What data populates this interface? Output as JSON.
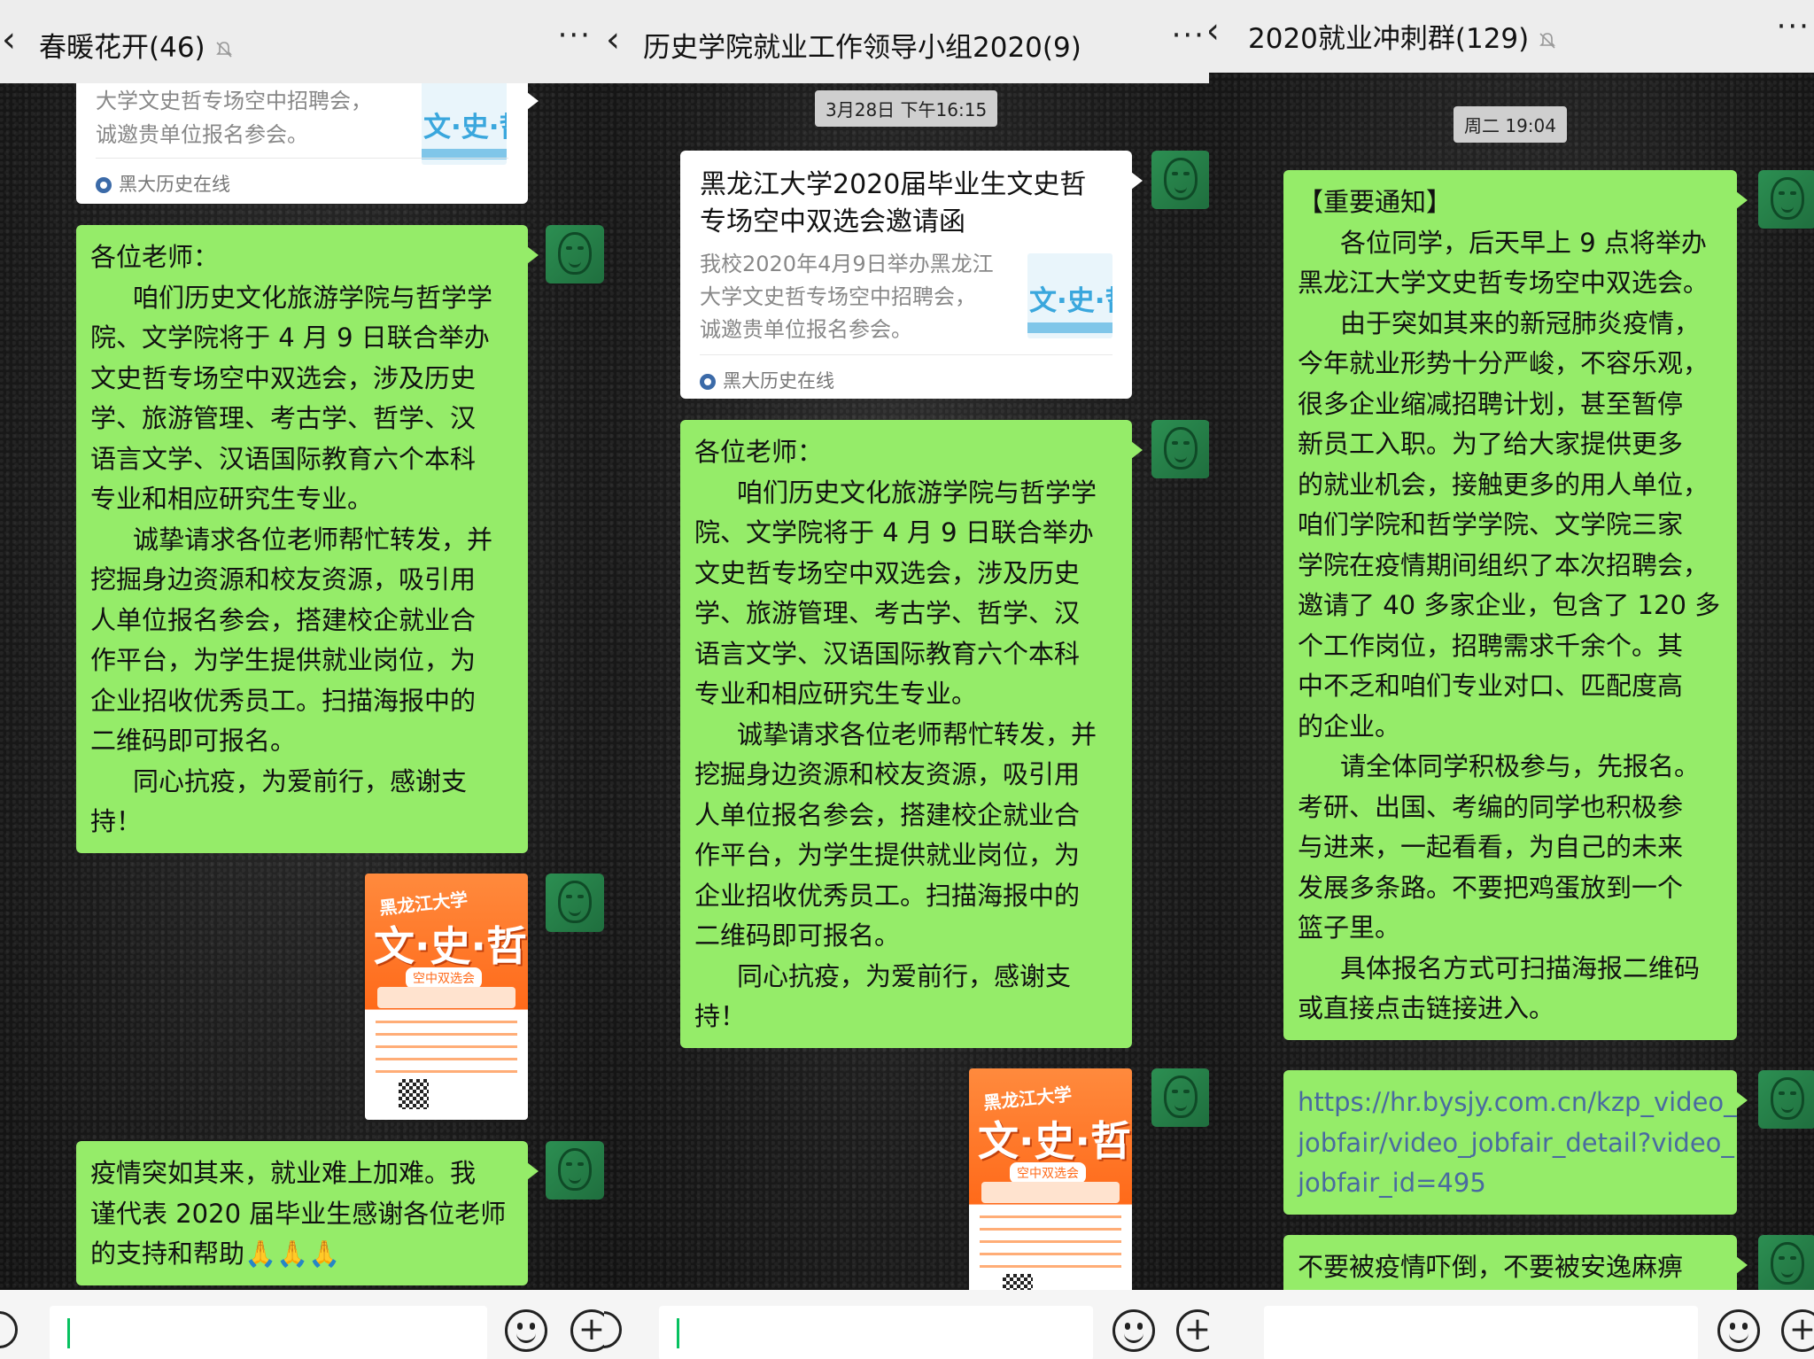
{
  "panels": [
    {
      "back_icon": "back-chevron-icon",
      "title": "春暖花开(46)",
      "muted_icon": "mute-bell-icon",
      "more": "···",
      "link_card": {
        "desc_lines": [
          "大学文史哲专场空中招聘会，",
          "诚邀贵单位报名参会。"
        ],
        "thumb_text": "文·史·哲",
        "source": "黑大历史在线"
      },
      "message_1": {
        "lines": [
          "各位老师：",
          "咱们历史文化旅游学院与哲学学",
          "院、文学院将于 4 月 9 日联合举办",
          "文史哲专场空中双选会，涉及历史",
          "学、旅游管理、考古学、哲学、汉",
          "语言文学、汉语国际教育六个本科",
          "专业和相应研究生专业。",
          "诚挚请求各位老师帮忙转发，并",
          "挖掘身边资源和校友资源，吸引用",
          "人单位报名参会，搭建校企就业合",
          "作平台，为学生提供就业岗位，为",
          "企业招收优秀员工。扫描海报中的",
          "二维码即可报名。",
          "同心抗疫，为爱前行，感谢支",
          "持！"
        ]
      },
      "poster": {
        "school": "黑龙江大学",
        "title": "文·史·哲",
        "subtitle": "空中双选会"
      },
      "message_2": {
        "lines": [
          "疫情突如其来，就业难上加难。我",
          "谨代表 2020 届毕业生感谢各位老师",
          "的支持和帮助"
        ],
        "emoji": "🙏🙏🙏"
      }
    },
    {
      "back_icon": "back-chevron-icon",
      "title": "历史学院就业工作领导小组2020(9)",
      "more": "···",
      "timestamp": "3月28日 下午16:15",
      "link_card": {
        "title_lines": [
          "黑龙江大学2020届毕业生文史哲",
          "专场空中双选会邀请函"
        ],
        "desc_lines": [
          "我校2020年4月9日举办黑龙江",
          "大学文史哲专场空中招聘会，",
          "诚邀贵单位报名参会。"
        ],
        "thumb_text": "文·史·哲",
        "source": "黑大历史在线"
      },
      "message_1": {
        "lines": [
          "各位老师：",
          "咱们历史文化旅游学院与哲学学",
          "院、文学院将于 4 月 9 日联合举办",
          "文史哲专场空中双选会，涉及历史",
          "学、旅游管理、考古学、哲学、汉",
          "语言文学、汉语国际教育六个本科",
          "专业和相应研究生专业。",
          "诚挚请求各位老师帮忙转发，并",
          "挖掘身边资源和校友资源，吸引用",
          "人单位报名参会，搭建校企就业合",
          "作平台，为学生提供就业岗位，为",
          "企业招收优秀员工。扫描海报中的",
          "二维码即可报名。",
          "同心抗疫，为爱前行，感谢支",
          "持！"
        ]
      },
      "poster": {
        "school": "黑龙江大学",
        "title": "文·史·哲",
        "subtitle": "空中双选会"
      }
    },
    {
      "back_icon": "back-chevron-icon",
      "title": "2020就业冲刺群(129)",
      "muted_icon": "mute-bell-icon",
      "more": "···",
      "timestamp": "周二 19:04",
      "message_1": {
        "lines": [
          "【重要通知】",
          "各位同学，后天早上 9 点将举办",
          "黑龙江大学文史哲专场空中双选会。",
          "由于突如其来的新冠肺炎疫情，",
          "今年就业形势十分严峻，不容乐观，",
          "很多企业缩减招聘计划，甚至暂停",
          "新员工入职。为了给大家提供更多",
          "的就业机会，接触更多的用人单位，",
          "咱们学院和哲学学院、文学院三家",
          "学院在疫情期间组织了本次招聘会，",
          "邀请了 40 多家企业，包含了 120 多",
          "个工作岗位，招聘需求千余个。其",
          "中不乏和咱们专业对口、匹配度高",
          "的企业。",
          "请全体同学积极参与，先报名。",
          "考研、出国、考编的同学也积极参",
          "与进来，一起看看，为自己的未来",
          "发展多条路。不要把鸡蛋放到一个",
          "篮子里。",
          "具体报名方式可扫描海报二维码",
          "或直接点击链接进入。"
        ]
      },
      "link_message": {
        "lines": [
          "https://hr.bysjy.com.cn/kzp_video_",
          "jobfair/video_jobfair_detail?video_",
          "jobfair_id=495"
        ]
      },
      "message_2": {
        "lines": [
          "不要被疫情吓倒，不要被安逸麻痹"
        ]
      }
    }
  ],
  "input_bar": {
    "voice_icon": "voice-icon",
    "emoji_icon": "emoji-icon",
    "plus_icon": "plus-icon"
  }
}
